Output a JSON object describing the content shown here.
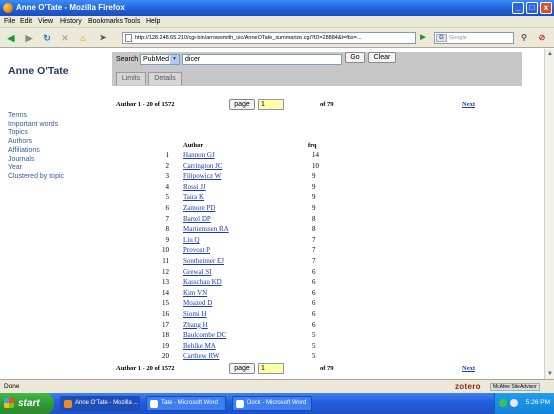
{
  "window": {
    "title": "Anne O'Tate - Mozilla Firefox",
    "minimize": "_",
    "maximize": "□",
    "close": "x"
  },
  "menu": [
    "File",
    "Edit",
    "View",
    "History",
    "Bookmarks",
    "Tools",
    "Help"
  ],
  "nav": {
    "url": "http://128.248.65.210/cgi-bin/arrowsmith_uic/AnneOTate_summarize.cgi?ID=28884&t=fbs=...",
    "search_placeholder": "Google",
    "search_engine": "G"
  },
  "app": {
    "logo": "Anne O'Tate",
    "search_label": "Search",
    "db_select": "PubMed",
    "query": "dicer",
    "go_button": "Go",
    "clear_button": "Clear",
    "tabs": [
      "Limits",
      "Details"
    ]
  },
  "sidebar": [
    "Terms",
    "Important words",
    "Topics",
    "Authors",
    "Affiliations",
    "Journals",
    "Year",
    "Clustered by topic"
  ],
  "pager": {
    "count": "Author 1 - 20 of 1572",
    "page_button": "page",
    "page_value": "1",
    "of": "of 79",
    "next": "Next"
  },
  "table": {
    "headers": [
      "Author",
      "frq"
    ],
    "rows": [
      {
        "n": "1",
        "author": "Hannon GJ",
        "frq": "14"
      },
      {
        "n": "2",
        "author": "Carrington JC",
        "frq": "10"
      },
      {
        "n": "3",
        "author": "Filipowicz W",
        "frq": "9"
      },
      {
        "n": "4",
        "author": "Rossi JJ",
        "frq": "9"
      },
      {
        "n": "5",
        "author": "Taira K",
        "frq": "9"
      },
      {
        "n": "6",
        "author": "Zamore PD",
        "frq": "9"
      },
      {
        "n": "7",
        "author": "Bartel DP",
        "frq": "8"
      },
      {
        "n": "8",
        "author": "Martienssen RA",
        "frq": "8"
      },
      {
        "n": "9",
        "author": "Liu Q",
        "frq": "7"
      },
      {
        "n": "10",
        "author": "Provost P",
        "frq": "7"
      },
      {
        "n": "11",
        "author": "Sontheimer EJ",
        "frq": "7"
      },
      {
        "n": "12",
        "author": "Grewal SI",
        "frq": "6"
      },
      {
        "n": "13",
        "author": "Kasschau KD",
        "frq": "6"
      },
      {
        "n": "14",
        "author": "Kim VN",
        "frq": "6"
      },
      {
        "n": "15",
        "author": "Moazed D",
        "frq": "6"
      },
      {
        "n": "16",
        "author": "Siomi H",
        "frq": "6"
      },
      {
        "n": "17",
        "author": "Zhang H",
        "frq": "6"
      },
      {
        "n": "18",
        "author": "Baulcombe DC",
        "frq": "5"
      },
      {
        "n": "19",
        "author": "Behlke MA",
        "frq": "5"
      },
      {
        "n": "20",
        "author": "Carthew RW",
        "frq": "5"
      }
    ]
  },
  "status": {
    "text": "Done",
    "zotero": "zotero",
    "addon": "McAfee SiteAdvisor"
  },
  "taskbar": {
    "start": "start",
    "tasks": [
      "Anne O'Tate - Mozilla ...",
      "Tate - Microsoft Word",
      "Dock - Microsoft Word"
    ],
    "clock": "5:26 PM"
  }
}
